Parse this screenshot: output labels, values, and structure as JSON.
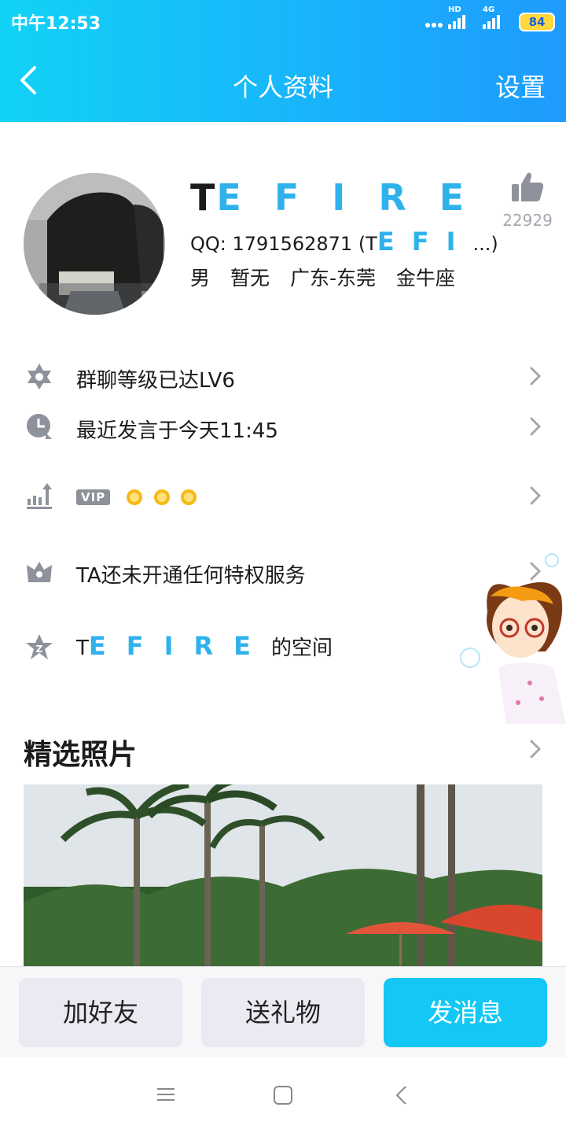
{
  "status_bar": {
    "time": "中午12:53",
    "hd": "HD",
    "network": "4G",
    "battery": "84"
  },
  "navbar": {
    "title": "个人资料",
    "right": "设置"
  },
  "profile": {
    "nickname_prefix": "T",
    "nickname_styled": "EFIRE",
    "likes": "22929",
    "qq_label": "QQ: 1791562871 (T",
    "qq_styled": "EFI",
    "qq_suffix": "...)",
    "tags": [
      "男",
      "暂无",
      "广东-东莞",
      "金牛座"
    ]
  },
  "list": {
    "group_level": "群聊等级已达LV6",
    "last_speak": "最近发言于今天11:45",
    "vip_badge": "VIP",
    "privilege": "TA还未开通任何特权服务",
    "space_prefix": "T",
    "space_styled": "EFIRE",
    "space_suffix": "的空间"
  },
  "photos": {
    "title": "精选照片"
  },
  "actions": {
    "add_friend": "加好友",
    "send_gift": "送礼物",
    "send_message": "发消息"
  },
  "colors": {
    "header_start": "#12d2f6",
    "header_end": "#1e9bfd",
    "accent": "#13c8f5",
    "styled_text": "#2fb2ec"
  }
}
